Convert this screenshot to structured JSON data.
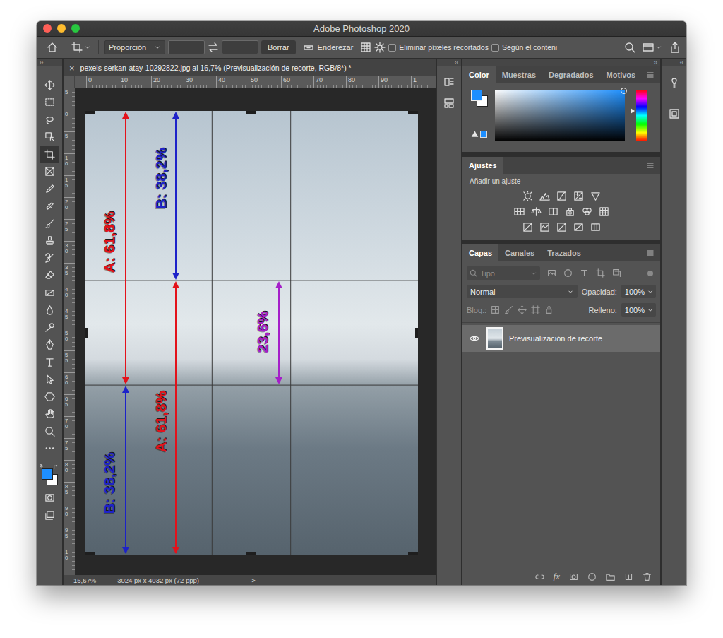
{
  "window": {
    "title": "Adobe Photoshop 2020"
  },
  "options_bar": {
    "preset": "Proporción",
    "clear": "Borrar",
    "straighten": "Enderezar",
    "checkboxes": [
      {
        "label": "Eliminar píxeles recortados",
        "checked": false
      },
      {
        "label": "Según el conteni",
        "checked": false
      }
    ]
  },
  "panel_toggles": [
    "››",
    "‹‹",
    "››",
    "‹‹"
  ],
  "toolbar": {
    "tools": [
      {
        "selected": false
      },
      {
        "selected": false
      },
      {
        "selected": false
      },
      {
        "selected": false
      },
      {
        "selected": true
      },
      {
        "selected": false
      },
      {
        "selected": false
      },
      {
        "selected": false
      },
      {
        "selected": false
      },
      {
        "selected": false
      },
      {
        "selected": false
      },
      {
        "selected": false
      },
      {
        "selected": false
      },
      {
        "selected": false
      },
      {
        "selected": false
      },
      {
        "selected": false
      },
      {
        "selected": false
      },
      {
        "selected": false
      },
      {
        "selected": false
      },
      {
        "selected": false
      },
      {
        "selected": false
      },
      {
        "selected": false
      }
    ]
  },
  "document": {
    "close": "×",
    "tab": "pexels-serkan-atay-10292822.jpg al 16,7% (Previsualización de recorte, RGB/8*) *",
    "ruler_top": [
      "0",
      "10",
      "20",
      "30",
      "40",
      "50",
      "60",
      "70",
      "80",
      "90",
      "1"
    ],
    "ruler_left": [
      "5",
      "0",
      "5",
      "10",
      "15",
      "20",
      "25",
      "30",
      "35",
      "40",
      "45",
      "50",
      "55",
      "60",
      "65",
      "70",
      "75",
      "80",
      "85",
      "90",
      "95",
      "10"
    ],
    "annotations": [
      {
        "label": "A: 61,8%",
        "color": "#e3121b"
      },
      {
        "label": "B: 38,2%",
        "color": "#1d22c9"
      },
      {
        "label": "A: 61,8%",
        "color": "#e3121b"
      },
      {
        "label": "B: 38,2%",
        "color": "#1d22c9"
      },
      {
        "label": "23,6%",
        "color": "#a51fc9"
      }
    ],
    "status": {
      "zoom": "16,67%",
      "size": "3024 px x 4032 px (72 ppp)",
      "more": ">"
    }
  },
  "color_panel": {
    "tabs": [
      {
        "label": "Color",
        "selected": true
      },
      {
        "label": "Muestras",
        "selected": false
      },
      {
        "label": "Degradados",
        "selected": false
      },
      {
        "label": "Motivos",
        "selected": false
      }
    ],
    "hue_level": 0.41,
    "picker": {
      "saturation": 0.99,
      "brightness": 0.99
    }
  },
  "adjustments_panel": {
    "tabs": [
      {
        "label": "Ajustes",
        "selected": true
      }
    ],
    "hint": "Añadir un ajuste"
  },
  "layers_panel": {
    "tabs": [
      {
        "label": "Capas",
        "selected": true
      },
      {
        "label": "Canales",
        "selected": false
      },
      {
        "label": "Trazados",
        "selected": false
      }
    ],
    "filter_placeholder": "Tipo",
    "blend_mode": "Normal",
    "opacity_label": "Opacidad:",
    "opacity": "100%",
    "lock_label": "Bloq.:",
    "fill_label": "Relleno:",
    "fill": "100%",
    "layers": [
      {
        "name": "Previsualización de recorte",
        "visible": true,
        "selected": true
      }
    ],
    "footer_fx": "fx"
  }
}
